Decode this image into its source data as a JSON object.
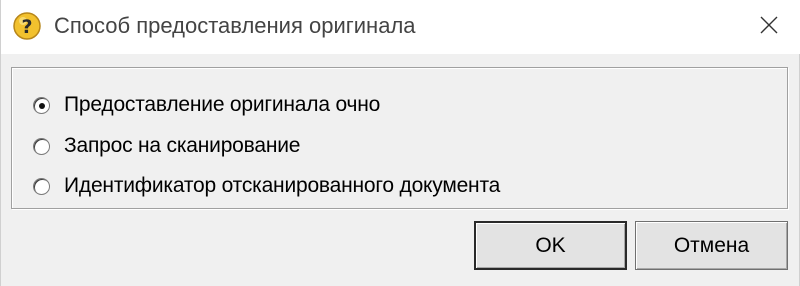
{
  "window": {
    "title": "Способ предоставления оригинала",
    "icon": "question-icon",
    "close_icon": "close-icon"
  },
  "options": [
    {
      "label": "Предоставление оригинала очно",
      "selected": true
    },
    {
      "label": "Запрос на сканирование",
      "selected": false
    },
    {
      "label": "Идентификатор отсканированного документа",
      "selected": false
    }
  ],
  "buttons": {
    "ok_label": "OK",
    "cancel_label": "Отмена"
  },
  "colors": {
    "titlebar": "#ffffff",
    "dialog_background": "#f0f0f0",
    "icon_yellow": "#f2c12e"
  }
}
